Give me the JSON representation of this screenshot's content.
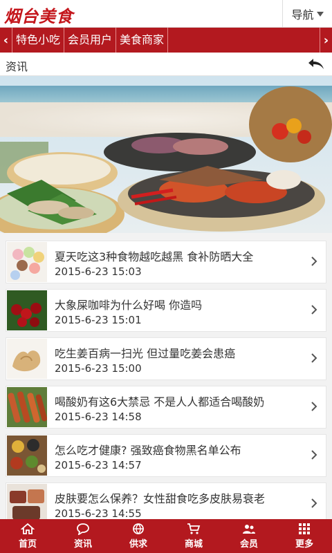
{
  "header": {
    "logo_text": "烟台美食",
    "nav_label": "导航"
  },
  "categories": [
    "特色小吃",
    "会员用户",
    "美食商家"
  ],
  "section": {
    "title": "资讯"
  },
  "news": [
    {
      "title": "夏天吃这3种食物越吃越黑 食补防晒大全",
      "date": "2015-6-23 15:03",
      "thumb": "ice-cream"
    },
    {
      "title": "大象屎咖啡为什么好喝 你造吗",
      "date": "2015-6-23 15:01",
      "thumb": "cherries"
    },
    {
      "title": "吃生姜百病一扫光 但过量吃姜会患癌",
      "date": "2015-6-23 15:00",
      "thumb": "ginger"
    },
    {
      "title": "喝酸奶有这6大禁忌 不是人人都适合喝酸奶",
      "date": "2015-6-23 14:58",
      "thumb": "sausages"
    },
    {
      "title": "怎么吃才健康? 强致癌食物黑名单公布",
      "date": "2015-6-23 14:57",
      "thumb": "spices"
    },
    {
      "title": "皮肤要怎么保养？女性甜食吃多皮肤易衰老",
      "date": "2015-6-23 14:55",
      "thumb": "sweets"
    }
  ],
  "tabs": [
    {
      "label": "首页",
      "icon": "home-icon"
    },
    {
      "label": "资讯",
      "icon": "chat-icon"
    },
    {
      "label": "供求",
      "icon": "globe-icon"
    },
    {
      "label": "商城",
      "icon": "cart-icon"
    },
    {
      "label": "会员",
      "icon": "users-icon"
    },
    {
      "label": "更多",
      "icon": "grid-icon"
    }
  ],
  "colors": {
    "brand_red": "#b3191f",
    "logo_red": "#c4161c"
  }
}
